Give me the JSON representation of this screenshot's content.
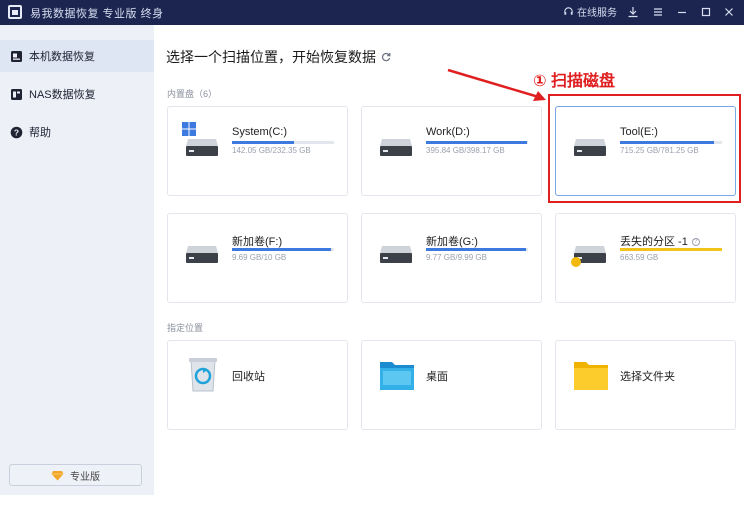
{
  "titlebar": {
    "app_title": "易我数据恢复 专业版 终身",
    "online_service": "在线服务"
  },
  "sidebar": {
    "items": [
      {
        "label": "本机数据恢复"
      },
      {
        "label": "NAS数据恢复"
      },
      {
        "label": "帮助"
      }
    ],
    "pro_button": "专业版"
  },
  "main": {
    "title": "选择一个扫描位置，开始恢复数据",
    "internal_disks_label": "内置盘（6）",
    "locations_label": "指定位置"
  },
  "drives": [
    {
      "name": "System(C:)",
      "size": "142.05 GB/232.35 GB",
      "usage": 0.61
    },
    {
      "name": "Work(D:)",
      "size": "395.84 GB/398.17 GB",
      "usage": 0.99
    },
    {
      "name": "Tool(E:)",
      "size": "715.25 GB/781.25 GB",
      "usage": 0.92
    },
    {
      "name": "新加卷(F:)",
      "size": "9.69 GB/10 GB",
      "usage": 0.97
    },
    {
      "name": "新加卷(G:)",
      "size": "9.77 GB/9.99 GB",
      "usage": 0.98
    },
    {
      "name": "丢失的分区 -1",
      "size": "663.59 GB",
      "usage": 1.0
    }
  ],
  "locations": [
    {
      "label": "回收站"
    },
    {
      "label": "桌面"
    },
    {
      "label": "选择文件夹"
    }
  ],
  "annotation": {
    "label": "① 扫描磁盘"
  },
  "colors": {
    "titlebar_bg": "#1b2550",
    "accent_blue": "#3d7ae0",
    "warning_yellow": "#f2c41b",
    "annotation_red": "#e02020"
  }
}
